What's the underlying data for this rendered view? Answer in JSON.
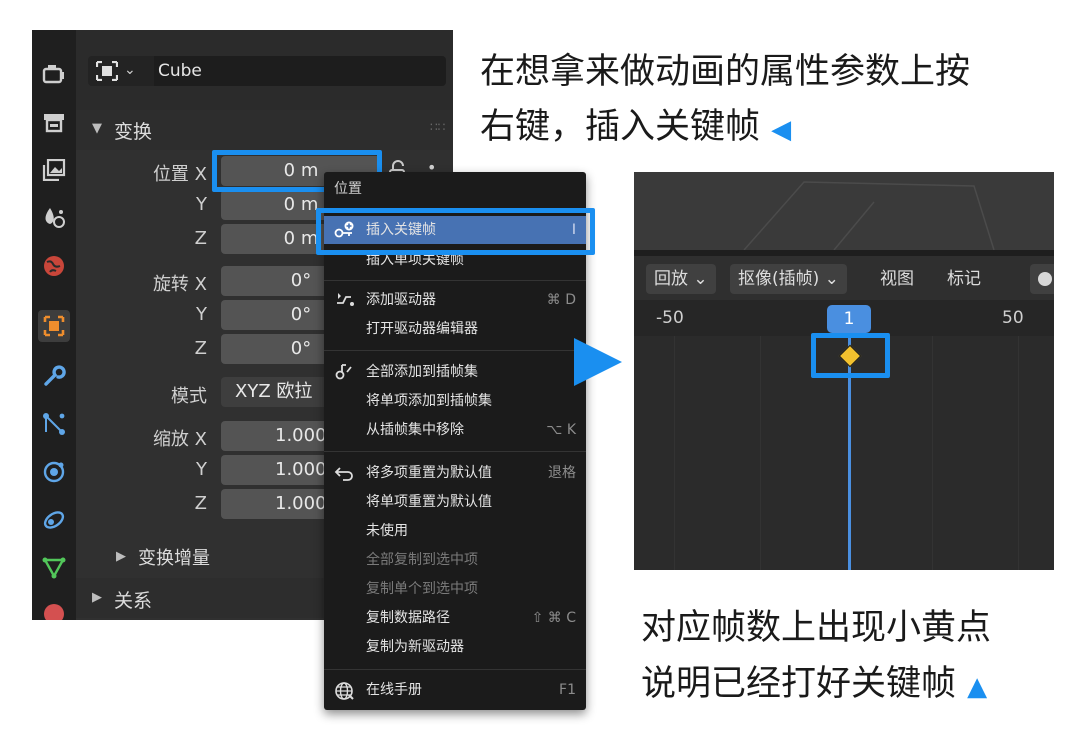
{
  "panel": {
    "object_name": "Cube",
    "section_transform": "变换",
    "location_label": "位置 X",
    "rotation_label": "旋转 X",
    "scale_label": "缩放 X",
    "y_label": "Y",
    "z_label": "Z",
    "location_value": "0 m",
    "rotation_value": "0°",
    "mode_label": "模式",
    "mode_value": "XYZ 欧拉",
    "scale_value": "1.000",
    "delta_transform": "变换增量",
    "relations": "关系"
  },
  "context_menu": {
    "title": "位置",
    "items": [
      {
        "label": "插入关键帧",
        "shortcut": "I"
      },
      {
        "label": "插入单项关键帧",
        "shortcut": ""
      },
      {
        "label": "添加驱动器",
        "shortcut": "⌘ D"
      },
      {
        "label": "打开驱动器编辑器",
        "shortcut": ""
      },
      {
        "label": "全部添加到插帧集",
        "shortcut": ""
      },
      {
        "label": "将单项添加到插帧集",
        "shortcut": ""
      },
      {
        "label": "从插帧集中移除",
        "shortcut": "⌥ K"
      },
      {
        "label": "将多项重置为默认值",
        "shortcut": "退格"
      },
      {
        "label": "将单项重置为默认值",
        "shortcut": ""
      },
      {
        "label": "未使用",
        "shortcut": ""
      },
      {
        "label": "全部复制到选中项",
        "shortcut": ""
      },
      {
        "label": "复制单个到选中项",
        "shortcut": ""
      },
      {
        "label": "复制数据路径",
        "shortcut": "⇧ ⌘ C"
      },
      {
        "label": "复制为新驱动器",
        "shortcut": ""
      },
      {
        "label": "在线手册",
        "shortcut": "F1"
      }
    ]
  },
  "timeline": {
    "playback": "回放",
    "keying": "抠像(插帧)",
    "view": "视图",
    "marker": "标记",
    "ruler": [
      "-50",
      "1",
      "50"
    ]
  },
  "annotations": {
    "top_line1": "在想拿来做动画的属性参数上按",
    "top_line2": "右键，插入关键帧",
    "bottom_line1": "对应帧数上出现小黄点",
    "bottom_line2": "说明已经打好关键帧"
  },
  "colors": {
    "highlight": "#1a8ff0",
    "keyframe": "#f2c12e",
    "playhead": "#4a8fe0",
    "menu_hover": "#4772b3"
  }
}
